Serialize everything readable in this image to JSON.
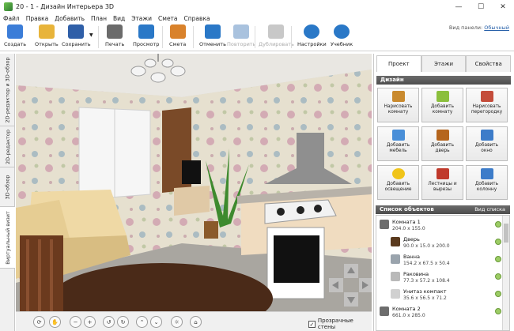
{
  "window": {
    "title": "20 - 1 - Дизайн Интерьера 3D",
    "buttons": [
      "—",
      "☐",
      "✕"
    ]
  },
  "menu": [
    "Файл",
    "Правка",
    "Добавить",
    "План",
    "Вид",
    "Этажи",
    "Смета",
    "Справка"
  ],
  "toolbar": {
    "buttons": [
      {
        "label": "Создать",
        "icon": "new-file-icon",
        "color": "#3b7dd8",
        "enabled": true
      },
      {
        "label": "Открыть",
        "icon": "open-folder-icon",
        "color": "#e8b43a",
        "enabled": true
      },
      {
        "label": "Сохранить",
        "icon": "save-floppy-icon",
        "color": "#2f5fa8",
        "enabled": true
      },
      {
        "label": "Печать",
        "icon": "printer-icon",
        "color": "#6b6b6b",
        "enabled": true
      },
      {
        "label": "Просмотр",
        "icon": "monitor-icon",
        "color": "#2a78c7",
        "enabled": true
      },
      {
        "label": "Смета",
        "icon": "estimate-icon",
        "color": "#d9822b",
        "enabled": true
      },
      {
        "label": "Отменить",
        "icon": "undo-icon",
        "color": "#2a78c7",
        "enabled": true
      },
      {
        "label": "Повторить",
        "icon": "redo-icon",
        "color": "#a9c2de",
        "enabled": false
      },
      {
        "label": "Дублировать",
        "icon": "duplicate-icon",
        "color": "#c8c8c8",
        "enabled": false
      },
      {
        "label": "Настройки",
        "icon": "gear-icon",
        "color": "#2a78c7",
        "enabled": true
      },
      {
        "label": "Учебник",
        "icon": "help-icon",
        "color": "#2a78c7",
        "enabled": true
      }
    ],
    "view_panel_label": "Вид панели:",
    "view_panel_value": "Обычный"
  },
  "left_tabs": [
    "2D-редактор и 3D-обзор",
    "2D-редактор",
    "3D-обзор",
    "Виртуальный визит"
  ],
  "bottom": {
    "transparent_walls_label": "Прозрачные стены",
    "transparent_walls_checked": true
  },
  "right_panel": {
    "tabs": [
      "Проект",
      "Этажи",
      "Свойства"
    ],
    "active_tab": "Проект",
    "design_title": "Дизайн",
    "design_buttons": [
      {
        "label": "Нарисовать\nкомнату",
        "icon": "draw-room-icon",
        "color": "#c98a2e"
      },
      {
        "label": "Добавить\nкомнату",
        "icon": "add-room-icon",
        "color": "#8bbf3c"
      },
      {
        "label": "Нарисовать\nперегородку",
        "icon": "partition-icon",
        "color": "#c44c3a"
      },
      {
        "label": "Добавить\nмебель",
        "icon": "furniture-icon",
        "color": "#4a8fd8"
      },
      {
        "label": "Добавить\nдверь",
        "icon": "door-icon",
        "color": "#b5651d"
      },
      {
        "label": "Добавить\nокно",
        "icon": "window-icon",
        "color": "#3d7cc9"
      },
      {
        "label": "Добавить\nосвещение",
        "icon": "lamp-icon",
        "color": "#f0c419"
      },
      {
        "label": "Лестницы и\nвырезы",
        "icon": "stairs-icon",
        "color": "#c0392b"
      },
      {
        "label": "Добавить\nколонну",
        "icon": "column-icon",
        "color": "#3d7cc9"
      }
    ],
    "list_title": "Список объектов",
    "list_view_label": "Вид списка",
    "objects": [
      {
        "name": "Комната 1",
        "dims": "204.0 x 155.0",
        "icon": "room-icon",
        "indent": 0
      },
      {
        "name": "Дверь",
        "dims": "90.0 x 15.0 x 200.0",
        "icon": "door-icon",
        "indent": 1
      },
      {
        "name": "Ванна",
        "dims": "154.2 x 67.5 x 50.4",
        "icon": "bathtub-icon",
        "indent": 1
      },
      {
        "name": "Раковина",
        "dims": "77.3 x 57.2 x 108.4",
        "icon": "sink-icon",
        "indent": 1
      },
      {
        "name": "Унитаз компакт",
        "dims": "35.6 x 56.5 x 71.2",
        "icon": "toilet-icon",
        "indent": 1
      },
      {
        "name": "Комната 2",
        "dims": "661.0 x 285.0",
        "icon": "room-icon",
        "indent": 0
      }
    ]
  }
}
